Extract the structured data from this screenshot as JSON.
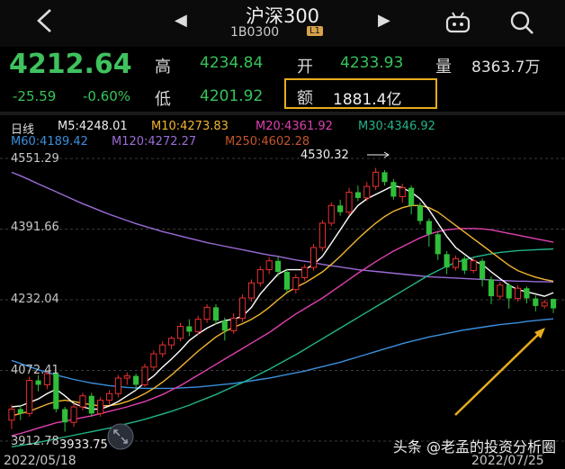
{
  "header": {
    "title": "沪深300",
    "code": "1B0300",
    "badge": "L1"
  },
  "quote": {
    "price": "4212.64",
    "change": "-25.59",
    "change_pct": "-0.60%",
    "high_label": "高",
    "high": "4234.84",
    "low_label": "低",
    "low": "4201.92",
    "open_label": "开",
    "open": "4233.93",
    "volume_label": "量",
    "volume": "8363.7万",
    "amount_label": "额",
    "amount": "1881.4亿"
  },
  "legend": {
    "period": "日线",
    "ma5": "M5:4248.01",
    "ma10": "M10:4273.83",
    "ma20": "M20:4361.92",
    "ma30": "M30:4346.92",
    "ma60": "M60:4189.42",
    "ma120": "M120:4272.27",
    "ma250": "M250:4602.28"
  },
  "colors": {
    "up": "#e83030",
    "down": "#2fbf3a",
    "ma5": "#ffffff",
    "ma10": "#f2b530",
    "ma20": "#e040b0",
    "ma30": "#22b48a",
    "ma60": "#3a8fdc",
    "ma120": "#9b6cd8",
    "ma250": "#c4552b",
    "accent": "#e7ac1e"
  },
  "chart_data": {
    "type": "candlestick",
    "y_ticks": [
      "4551.29",
      "4391.66",
      "4232.04",
      "4072.41",
      "3912.78"
    ],
    "ylim": [
      3912.78,
      4551.29
    ],
    "x_labels": [
      "2022/05/18",
      "2022/07/25"
    ],
    "max_label": "4530.32",
    "min_label": "3933.75",
    "candles": [
      [
        3960,
        3985,
        3940,
        3995
      ],
      [
        3985,
        3975,
        3960,
        3995
      ],
      [
        3975,
        4050,
        3968,
        4058
      ],
      [
        4050,
        4040,
        4025,
        4062
      ],
      [
        4040,
        4065,
        4030,
        4072
      ],
      [
        4065,
        3985,
        3978,
        4070
      ],
      [
        3985,
        3955,
        3934,
        3990
      ],
      [
        3955,
        3990,
        3945,
        3998
      ],
      [
        3990,
        4015,
        3982,
        4022
      ],
      [
        4015,
        3975,
        3968,
        4022
      ],
      [
        3975,
        4005,
        3968,
        4012
      ],
      [
        4005,
        4020,
        3995,
        4028
      ],
      [
        4020,
        4055,
        4012,
        4062
      ],
      [
        4055,
        4060,
        4040,
        4068
      ],
      [
        4060,
        4040,
        4028,
        4065
      ],
      [
        4040,
        4080,
        4035,
        4088
      ],
      [
        4080,
        4110,
        4072,
        4118
      ],
      [
        4110,
        4130,
        4102,
        4138
      ],
      [
        4130,
        4145,
        4120,
        4150
      ],
      [
        4145,
        4172,
        4138,
        4180
      ],
      [
        4172,
        4160,
        4150,
        4188
      ],
      [
        4160,
        4188,
        4152,
        4196
      ],
      [
        4188,
        4215,
        4180,
        4222
      ],
      [
        4215,
        4185,
        4176,
        4222
      ],
      [
        4185,
        4162,
        4140,
        4192
      ],
      [
        4162,
        4190,
        4155,
        4202
      ],
      [
        4190,
        4236,
        4182,
        4244
      ],
      [
        4236,
        4270,
        4228,
        4278
      ],
      [
        4270,
        4300,
        4262,
        4308
      ],
      [
        4300,
        4320,
        4290,
        4328
      ],
      [
        4320,
        4295,
        4285,
        4330
      ],
      [
        4295,
        4255,
        4248,
        4302
      ],
      [
        4255,
        4282,
        4246,
        4290
      ],
      [
        4282,
        4305,
        4275,
        4312
      ],
      [
        4305,
        4350,
        4298,
        4358
      ],
      [
        4350,
        4405,
        4342,
        4412
      ],
      [
        4405,
        4445,
        4398,
        4452
      ],
      [
        4445,
        4430,
        4422,
        4458
      ],
      [
        4430,
        4475,
        4422,
        4485
      ],
      [
        4475,
        4462,
        4455,
        4490
      ],
      [
        4462,
        4488,
        4455,
        4498
      ],
      [
        4488,
        4520,
        4480,
        4530
      ],
      [
        4520,
        4498,
        4490,
        4525
      ],
      [
        4498,
        4465,
        4458,
        4505
      ],
      [
        4465,
        4485,
        4452,
        4494
      ],
      [
        4485,
        4445,
        4425,
        4490
      ],
      [
        4445,
        4410,
        4402,
        4452
      ],
      [
        4410,
        4380,
        4352,
        4416
      ],
      [
        4380,
        4335,
        4322,
        4386
      ],
      [
        4335,
        4305,
        4290,
        4342
      ],
      [
        4305,
        4325,
        4298,
        4332
      ],
      [
        4325,
        4298,
        4290,
        4330
      ],
      [
        4298,
        4320,
        4292,
        4328
      ],
      [
        4320,
        4278,
        4262,
        4325
      ],
      [
        4278,
        4240,
        4222,
        4285
      ],
      [
        4240,
        4265,
        4232,
        4272
      ],
      [
        4265,
        4235,
        4212,
        4270
      ],
      [
        4235,
        4258,
        4228,
        4265
      ],
      [
        4258,
        4235,
        4224,
        4262
      ],
      [
        4235,
        4218,
        4206,
        4242
      ],
      [
        4218,
        4226,
        4212,
        4232
      ],
      [
        4233.93,
        4212.64,
        4201.92,
        4234.84
      ]
    ],
    "ma5": [
      3990,
      3992,
      4000,
      4008,
      4020,
      4030,
      4015,
      3998,
      3990,
      3985,
      3985,
      3992,
      4002,
      4015,
      4028,
      4045,
      4060,
      4080,
      4098,
      4118,
      4140,
      4155,
      4168,
      4178,
      4185,
      4188,
      4195,
      4215,
      4245,
      4268,
      4290,
      4300,
      4300,
      4300,
      4312,
      4330,
      4360,
      4390,
      4420,
      4445,
      4460,
      4470,
      4480,
      4490,
      4485,
      4475,
      4460,
      4435,
      4405,
      4375,
      4350,
      4335,
      4320,
      4312,
      4295,
      4280,
      4265,
      4255,
      4250,
      4245,
      4240,
      4248
    ],
    "ma10": [
      3970,
      3975,
      3980,
      3988,
      3996,
      4002,
      4005,
      4002,
      3998,
      3995,
      3992,
      3993,
      3996,
      4002,
      4010,
      4020,
      4032,
      4046,
      4062,
      4080,
      4098,
      4116,
      4132,
      4148,
      4160,
      4170,
      4178,
      4188,
      4200,
      4215,
      4232,
      4248,
      4260,
      4270,
      4282,
      4295,
      4312,
      4330,
      4350,
      4370,
      4388,
      4405,
      4420,
      4432,
      4440,
      4445,
      4445,
      4440,
      4430,
      4415,
      4400,
      4385,
      4370,
      4355,
      4340,
      4325,
      4310,
      4298,
      4290,
      4283,
      4278,
      4274
    ],
    "ma20": [
      3925,
      3930,
      3936,
      3942,
      3948,
      3954,
      3958,
      3962,
      3966,
      3970,
      3975,
      3980,
      3985,
      3990,
      3996,
      4002,
      4010,
      4018,
      4028,
      4038,
      4050,
      4062,
      4074,
      4086,
      4098,
      4110,
      4122,
      4134,
      4146,
      4158,
      4172,
      4186,
      4200,
      4212,
      4224,
      4236,
      4250,
      4264,
      4278,
      4292,
      4305,
      4318,
      4330,
      4342,
      4352,
      4362,
      4372,
      4380,
      4386,
      4390,
      4392,
      4393,
      4393,
      4392,
      4390,
      4386,
      4382,
      4378,
      4374,
      4370,
      4366,
      4362
    ],
    "ma30": [
      3900,
      3903,
      3906,
      3910,
      3914,
      3918,
      3922,
      3926,
      3930,
      3934,
      3938,
      3942,
      3947,
      3952,
      3957,
      3962,
      3968,
      3974,
      3980,
      3987,
      3994,
      4002,
      4010,
      4018,
      4027,
      4036,
      4045,
      4055,
      4065,
      4075,
      4086,
      4097,
      4108,
      4120,
      4132,
      4144,
      4156,
      4168,
      4180,
      4192,
      4204,
      4216,
      4228,
      4240,
      4252,
      4264,
      4276,
      4288,
      4298,
      4308,
      4316,
      4322,
      4328,
      4332,
      4336,
      4339,
      4341,
      4343,
      4344,
      4345,
      4346,
      4347
    ],
    "ma60": [
      4095,
      4088,
      4081,
      4074,
      4068,
      4062,
      4057,
      4052,
      4048,
      4044,
      4041,
      4038,
      4036,
      4034,
      4033,
      4032,
      4032,
      4032,
      4032,
      4033,
      4034,
      4035,
      4037,
      4039,
      4041,
      4043,
      4046,
      4049,
      4052,
      4055,
      4059,
      4063,
      4067,
      4071,
      4076,
      4081,
      4086,
      4091,
      4097,
      4103,
      4109,
      4115,
      4121,
      4127,
      4133,
      4138,
      4143,
      4148,
      4152,
      4156,
      4160,
      4164,
      4167,
      4170,
      4173,
      4176,
      4178,
      4180,
      4183,
      4185,
      4187,
      4189
    ],
    "ma120": [
      4520,
      4512,
      4503,
      4494,
      4485,
      4476,
      4467,
      4458,
      4449,
      4441,
      4433,
      4425,
      4418,
      4411,
      4404,
      4398,
      4392,
      4386,
      4381,
      4376,
      4371,
      4366,
      4361,
      4357,
      4353,
      4349,
      4345,
      4341,
      4337,
      4333,
      4330,
      4326,
      4322,
      4319,
      4316,
      4312,
      4309,
      4306,
      4303,
      4300,
      4298,
      4296,
      4294,
      4292,
      4290,
      4288,
      4286,
      4284,
      4283,
      4282,
      4281,
      4280,
      4279,
      4278,
      4277,
      4276,
      4275,
      4274,
      4274,
      4273,
      4273,
      4272
    ]
  },
  "watermark": "头条 @老孟的投资分析圈"
}
